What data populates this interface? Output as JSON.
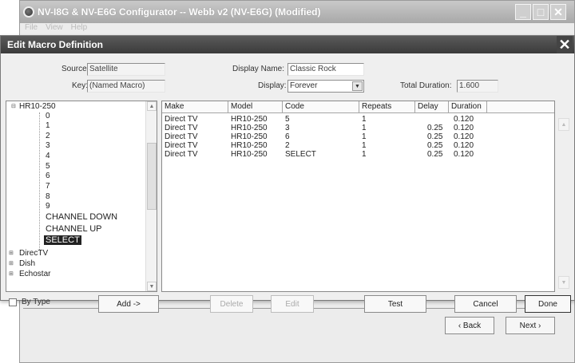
{
  "app_window": {
    "title": "NV-I8G & NV-E6G Configurator -- Webb v2 (NV-E6G) (Modified)",
    "menu": [
      "File",
      "View",
      "Help"
    ],
    "back_label": "‹ Back",
    "next_label": "Next ›"
  },
  "dialog": {
    "title": "Edit Macro Definition",
    "close_icon": "close-icon",
    "fields": {
      "source_label": "Source:",
      "source_value": "Satellite",
      "key_label": "Key:",
      "key_value": "(Named Macro)",
      "display_name_label": "Display Name:",
      "display_name_value": "Classic Rock",
      "display_label": "Display:",
      "display_value": "Forever",
      "total_duration_label": "Total Duration:",
      "total_duration_value": "1.600"
    },
    "tree": {
      "root": "HR10-250",
      "codes": [
        "0",
        "1",
        "2",
        "3",
        "4",
        "5",
        "6",
        "7",
        "8",
        "9"
      ],
      "commands": [
        "CHANNEL DOWN",
        "CHANNEL UP",
        "SELECT"
      ],
      "selected": "SELECT",
      "groups": [
        "DirecTV",
        "Dish",
        "Echostar"
      ]
    },
    "table": {
      "columns": [
        "Make",
        "Model",
        "Code",
        "Repeats",
        "Delay",
        "Duration"
      ],
      "rows": [
        {
          "make": "Direct TV",
          "model": "HR10-250",
          "code": "5",
          "repeats": "1",
          "delay": "",
          "duration": "0.120"
        },
        {
          "make": "Direct TV",
          "model": "HR10-250",
          "code": "3",
          "repeats": "1",
          "delay": "0.25",
          "duration": "0.120"
        },
        {
          "make": "Direct TV",
          "model": "HR10-250",
          "code": "6",
          "repeats": "1",
          "delay": "0.25",
          "duration": "0.120"
        },
        {
          "make": "Direct TV",
          "model": "HR10-250",
          "code": "2",
          "repeats": "1",
          "delay": "0.25",
          "duration": "0.120"
        },
        {
          "make": "Direct TV",
          "model": "HR10-250",
          "code": "SELECT",
          "repeats": "1",
          "delay": "0.25",
          "duration": "0.120"
        }
      ]
    },
    "by_type_label": "By Type",
    "buttons": {
      "add": "Add ->",
      "delete": "Delete",
      "edit": "Edit",
      "test": "Test",
      "cancel": "Cancel",
      "done": "Done"
    }
  }
}
